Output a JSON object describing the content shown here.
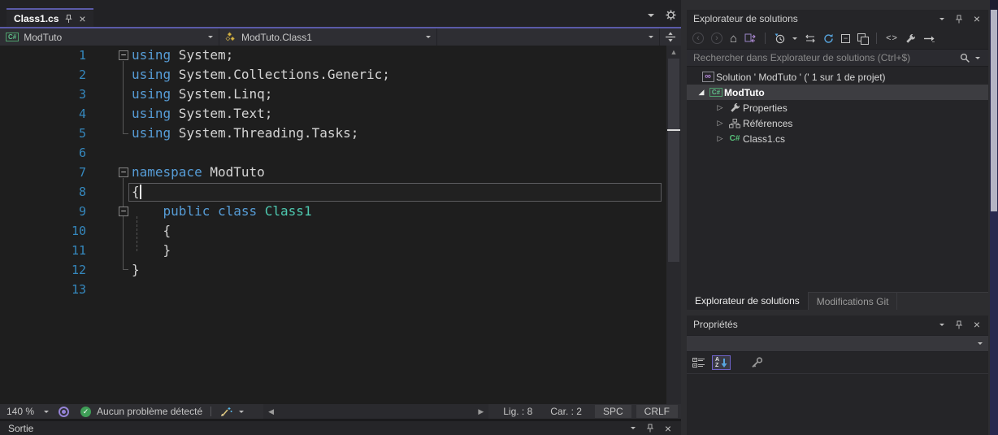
{
  "editor": {
    "tab_title": "Class1.cs",
    "navbar": {
      "project_combo": "ModTuto",
      "member_combo": "ModTuto.Class1"
    },
    "code": {
      "lines": [
        {
          "num": "1",
          "fold": true,
          "segs": [
            [
              "kw",
              "using"
            ],
            [
              "pl",
              " System;"
            ]
          ]
        },
        {
          "num": "2",
          "segs": [
            [
              "kw",
              "using"
            ],
            [
              "pl",
              " System.Collections.Generic;"
            ]
          ]
        },
        {
          "num": "3",
          "segs": [
            [
              "kw",
              "using"
            ],
            [
              "pl",
              " System.Linq;"
            ]
          ]
        },
        {
          "num": "4",
          "segs": [
            [
              "kw",
              "using"
            ],
            [
              "pl",
              " System.Text;"
            ]
          ]
        },
        {
          "num": "5",
          "segs": [
            [
              "kw",
              "using"
            ],
            [
              "pl",
              " System.Threading.Tasks;"
            ]
          ]
        },
        {
          "num": "6",
          "segs": []
        },
        {
          "num": "7",
          "fold": true,
          "segs": [
            [
              "kw",
              "namespace"
            ],
            [
              "pl",
              " ModTuto"
            ]
          ]
        },
        {
          "num": "8",
          "current": true,
          "segs": [
            [
              "pl",
              "{"
            ]
          ]
        },
        {
          "num": "9",
          "fold": true,
          "segs": [
            [
              "pl",
              "    "
            ],
            [
              "kw",
              "public"
            ],
            [
              "pl",
              " "
            ],
            [
              "kw",
              "class"
            ],
            [
              "ty",
              " Class1"
            ]
          ]
        },
        {
          "num": "10",
          "segs": [
            [
              "pl",
              "    {"
            ]
          ]
        },
        {
          "num": "11",
          "segs": [
            [
              "pl",
              "    }"
            ]
          ]
        },
        {
          "num": "12",
          "segs": [
            [
              "pl",
              "}"
            ]
          ]
        },
        {
          "num": "13",
          "segs": []
        }
      ],
      "colors": {
        "keyword": "#569cd6",
        "plain": "#d4d4d4",
        "type": "#4ec9b0",
        "line_number": "#3588be",
        "background": "#1e1e1e"
      }
    },
    "status_bar": {
      "zoom": "140 %",
      "problems": "Aucun problème détecté",
      "line": "Lig. : 8",
      "column": "Car. : 2",
      "spaces": "SPC",
      "line_ending": "CRLF"
    }
  },
  "output_panel": {
    "title": "Sortie"
  },
  "solution_explorer": {
    "title": "Explorateur de solutions",
    "search_placeholder": "Rechercher dans Explorateur de solutions (Ctrl+$)",
    "tree": [
      {
        "label": "Solution ' ModTuto ' (' 1 sur 1 de projet)",
        "icon": "solution",
        "indent": 14,
        "arrow": "none"
      },
      {
        "label": "ModTuto",
        "icon": "project",
        "indent": 10,
        "arrow": "expanded",
        "selected": true,
        "bold": true
      },
      {
        "label": "Properties",
        "icon": "wrench",
        "indent": 33,
        "arrow": "collapsed"
      },
      {
        "label": "Références",
        "icon": "references",
        "indent": 33,
        "arrow": "collapsed"
      },
      {
        "label": "Class1.cs",
        "icon": "csfile",
        "indent": 33,
        "arrow": "collapsed"
      }
    ],
    "bottom_tabs": [
      {
        "label": "Explorateur de solutions",
        "active": true
      },
      {
        "label": "Modifications Git",
        "active": false
      }
    ]
  },
  "properties_panel": {
    "title": "Propriétés",
    "object_combo_value": ""
  },
  "icons": {
    "close": "×",
    "minus": "−",
    "home": "⌂",
    "infinity": "∞",
    "code_view": "<>",
    "check": "✓",
    "up_arrow": "▲",
    "left_arrow": "◀",
    "right_arrow": "▶",
    "collapsed_arrow": "▷",
    "expanded_arrow": "◢",
    "back_arrow": "‹",
    "forward_arrow": "›"
  },
  "accent_colors": {
    "tab_accent": "#5a5aa8",
    "selection_row": "#3d3d41",
    "refresh_blue": "#58a6e0",
    "check_green": "#3f9e57"
  }
}
